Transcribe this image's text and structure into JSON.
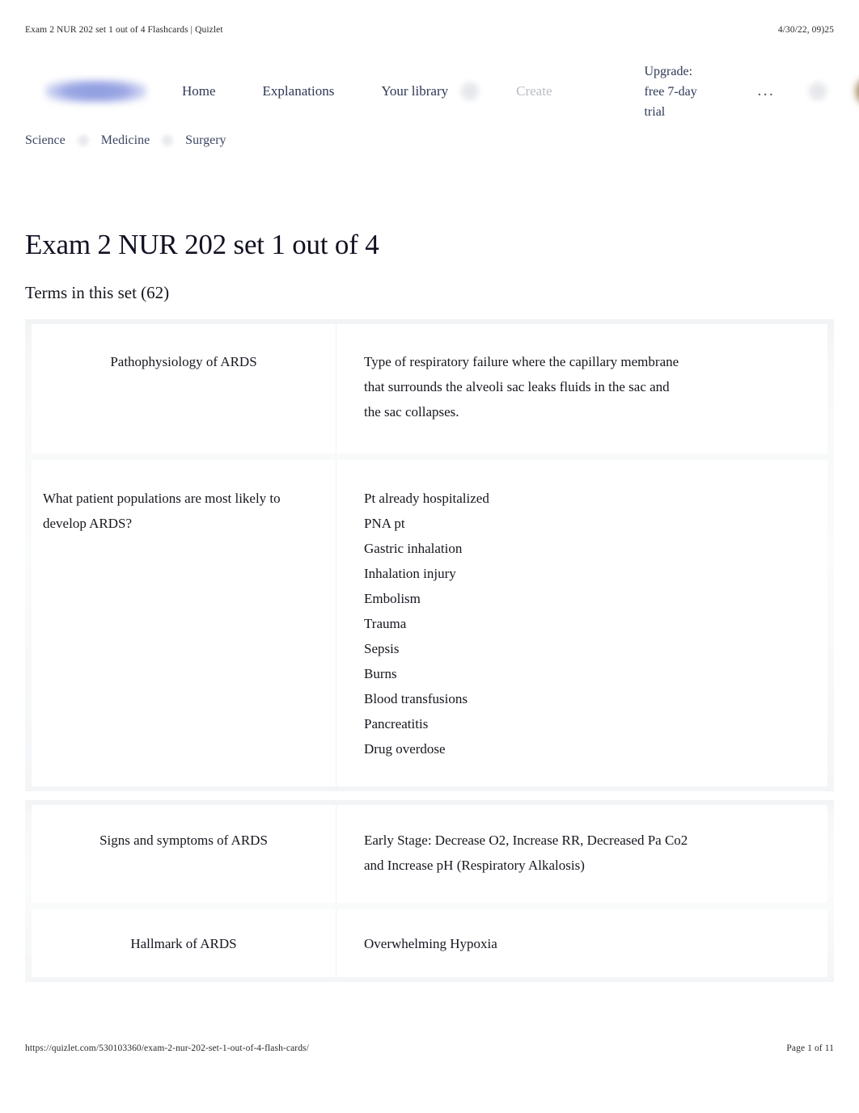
{
  "print_chrome": {
    "header_title": "Exam 2 NUR 202 set 1 out of 4 Flashcards | Quizlet",
    "header_timestamp": "4/30/22, 09)25",
    "footer_url": "https://quizlet.com/530103360/exam-2-nur-202-set-1-out-of-4-flash-cards/",
    "footer_page": "Page 1 of 11"
  },
  "nav": {
    "logo_alt": "quizlet-logo",
    "links": [
      {
        "label": "Home",
        "muted": false
      },
      {
        "label": "Explanations",
        "muted": false
      },
      {
        "label": "Your library",
        "muted": false
      },
      {
        "label": "Create",
        "muted": true
      }
    ],
    "upgrade_label": "Upgrade: free 7-day trial",
    "more_label": "...",
    "avatar_alt": "user-avatar"
  },
  "breadcrumb": {
    "items": [
      "Science",
      "Medicine",
      "Surgery"
    ]
  },
  "header": {
    "title": "Exam 2 NUR 202 set 1 out of 4",
    "terms_count_label": "Terms in this set (62)"
  },
  "flashcards": [
    {
      "term": "Pathophysiology of ARDS",
      "term_align": "center",
      "definition_lines": [
        "Type of respiratory failure where the capillary membrane",
        "that surrounds the alveoli sac leaks fluids in the sac and",
        "the sac collapses."
      ]
    },
    {
      "term": "What patient populations are most likely to develop ARDS?",
      "term_align": "left",
      "definition_lines": [
        "Pt already hospitalized",
        "PNA pt",
        "Gastric inhalation",
        "Inhalation injury",
        "Embolism",
        "Trauma",
        "Sepsis",
        "Burns",
        "Blood transfusions",
        "Pancreatitis",
        "Drug overdose"
      ]
    },
    {
      "term": "Signs and symptoms of ARDS",
      "term_align": "center",
      "definition_lines": [
        "Early Stage: Decrease O2, Increase RR, Decreased Pa Co2",
        "and Increase pH (Respiratory Alkalosis)"
      ]
    },
    {
      "term": "Hallmark of ARDS",
      "term_align": "center",
      "definition_lines": [
        "Overwhelming Hypoxia"
      ]
    }
  ],
  "colors": {
    "logo_periwinkle": "#8e9ce0",
    "avatar_brown": "#a2835c",
    "text_primary": "#16161f",
    "text_muted": "#b9bcc4",
    "card_bg": "#ffffff",
    "group_bg": "#f7f8f9"
  }
}
